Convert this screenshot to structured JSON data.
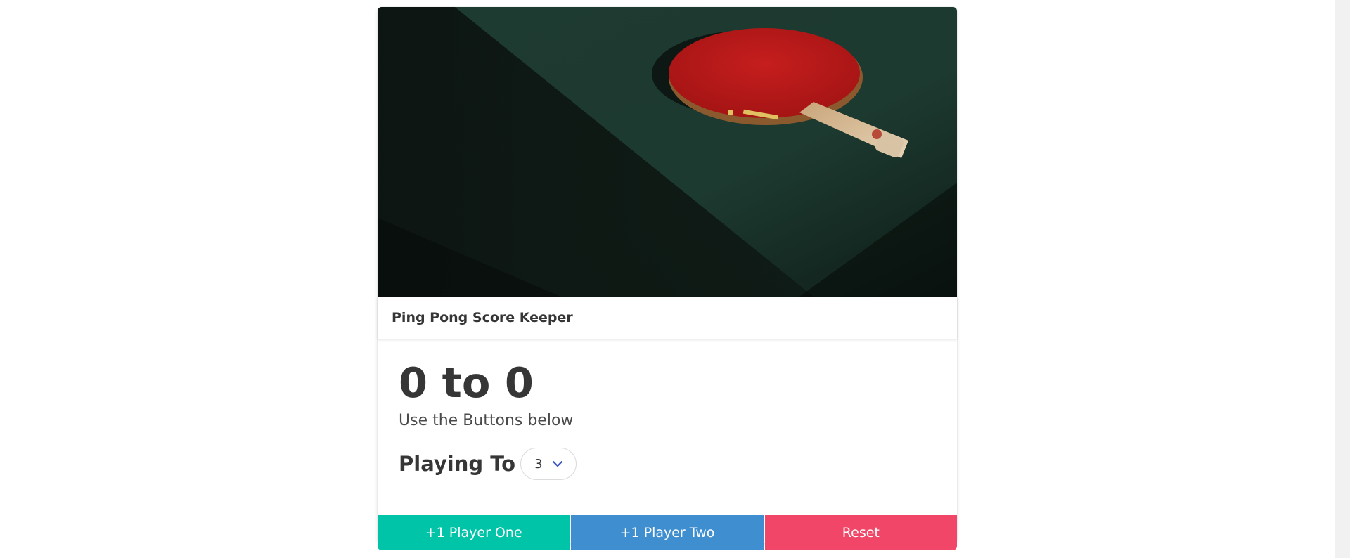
{
  "card": {
    "image_alt": "Ping pong paddle on table",
    "header_title": "Ping Pong Score Keeper"
  },
  "score": {
    "player_one": "0",
    "separator": "to",
    "player_two": "0"
  },
  "instructions": "Use the Buttons below",
  "playing_to": {
    "label": "Playing To",
    "selected": "3"
  },
  "buttons": {
    "player_one": "+1 Player One",
    "player_two": "+1 Player Two",
    "reset": "Reset"
  },
  "colors": {
    "player_one_button": "#00c4a7",
    "player_two_button": "#3e8ed0",
    "reset_button": "#f14668",
    "chevron": "#3e56c4"
  },
  "icons": {
    "select_arrow": "chevron-down-icon"
  }
}
